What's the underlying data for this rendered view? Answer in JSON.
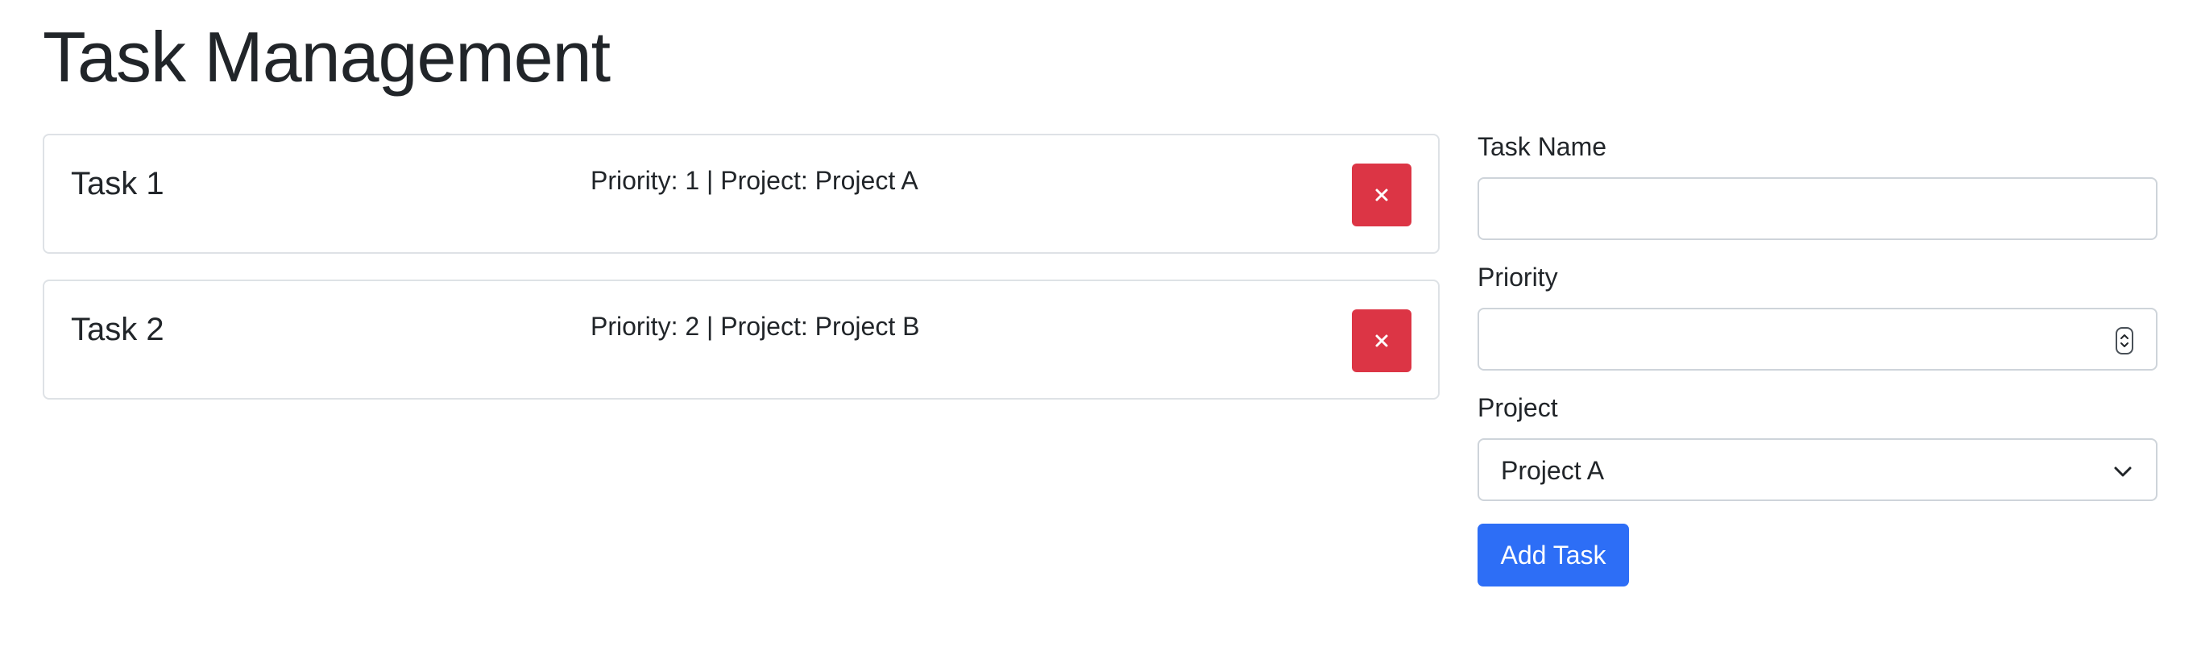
{
  "page": {
    "title": "Task Management"
  },
  "tasks": [
    {
      "name": "Task 1",
      "meta": "Priority: 1 | Project: Project A",
      "delete_label": "×"
    },
    {
      "name": "Task 2",
      "meta": "Priority: 2 | Project: Project B",
      "delete_label": "×"
    }
  ],
  "form": {
    "task_name_label": "Task Name",
    "task_name_value": "",
    "priority_label": "Priority",
    "priority_value": "",
    "project_label": "Project",
    "project_selected": "Project A",
    "submit_label": "Add Task"
  },
  "colors": {
    "delete": "#dc3545",
    "primary": "#2d6ef6",
    "border": "#dee2e6"
  },
  "icons": {
    "delete": "close-icon",
    "spinner": "number-spinner-icon",
    "select": "chevron-down-icon"
  }
}
